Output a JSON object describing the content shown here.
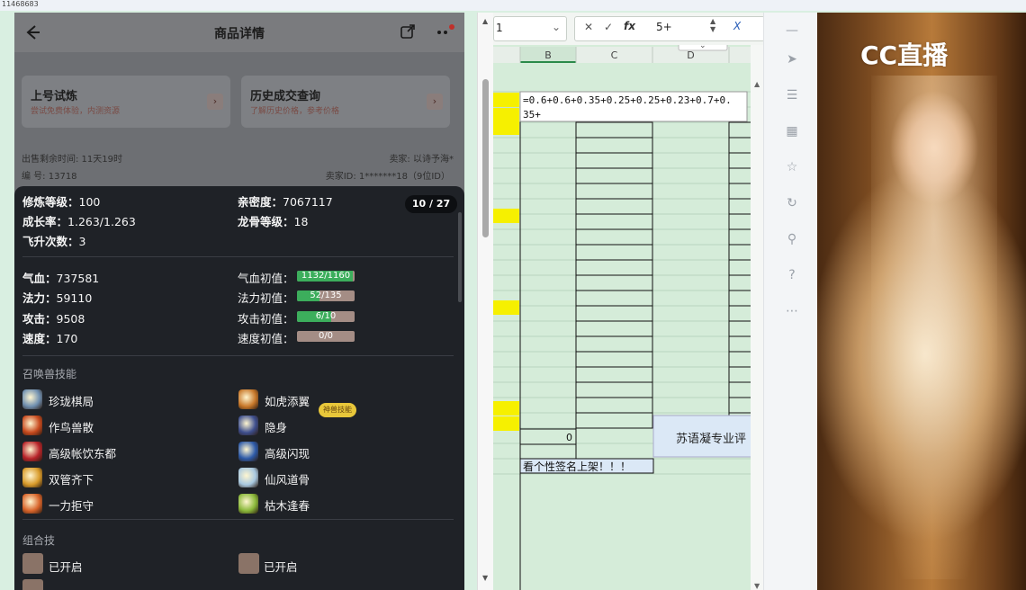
{
  "top_strip": {
    "text": "11468683"
  },
  "phone": {
    "header_title": "商品详情",
    "cards": [
      {
        "title": "上号试炼",
        "subtitle": "尝试免费体验，内测资源"
      },
      {
        "title": "历史成交查询",
        "subtitle": "了解历史价格，参考价格"
      }
    ],
    "meta": {
      "sell_time": "出售剩余时间: 11天19时",
      "seller": "卖家: 以诗予海*",
      "serial": "编 号: 13718",
      "seller_id": "卖家ID: 1*******18（9位ID）"
    },
    "detail": {
      "page_badge": "10 / 27",
      "stats_top": [
        {
          "label": "修炼等级：",
          "value": "100"
        },
        {
          "label": "亲密度：",
          "value": "7067117"
        },
        {
          "label": "成长率：",
          "value": "1.263/1.263"
        },
        {
          "label": "龙骨等级：",
          "value": "18"
        },
        {
          "label": "飞升次数：",
          "value": "3"
        }
      ],
      "stats_main": [
        {
          "label": "气血：",
          "value": "737581"
        },
        {
          "label": "法力：",
          "value": "59110"
        },
        {
          "label": "攻击：",
          "value": "9508"
        },
        {
          "label": "速度：",
          "value": "170"
        }
      ],
      "initials": [
        {
          "label": "气血初值：",
          "text": "1132/1160",
          "fraction": 0.976
        },
        {
          "label": "法力初值：",
          "text": "52/135",
          "fraction": 0.385
        },
        {
          "label": "攻击初值：",
          "text": "6/10",
          "fraction": 0.6
        },
        {
          "label": "速度初值：",
          "text": "0/0",
          "fraction": 0
        }
      ],
      "skills_title": "召唤兽技能",
      "skills": [
        {
          "name": "珍珑棋局",
          "color": "#6f8fb0"
        },
        {
          "name": "如虎添翼",
          "color": "#c8782a"
        },
        {
          "name": "作鸟兽散",
          "color": "#c84a1e"
        },
        {
          "name": "隐身",
          "color": "#3e4f8e"
        },
        {
          "name": "高级帐饮东都",
          "color": "#b8242a"
        },
        {
          "name": "高级闪现",
          "color": "#2d5aa8"
        },
        {
          "name": "双管齐下",
          "color": "#d89a2a"
        },
        {
          "name": "仙风道骨",
          "color": "#a8c8e0"
        },
        {
          "name": "一力拒守",
          "color": "#d8642a"
        },
        {
          "name": "枯木逢春",
          "color": "#8ab83a"
        }
      ],
      "special_badge": "神兽技能",
      "combo_title": "组合技",
      "combos": [
        {
          "label": "已开启"
        },
        {
          "label": "已开启"
        }
      ]
    }
  },
  "sheet": {
    "name_box": "1",
    "formula_value": "5+",
    "columns": [
      "B",
      "C",
      "D"
    ],
    "formula_text_line1": "=0.6+0.6+0.35+0.25+0.25+0.23+0.7+0.",
    "formula_text_line2": "35+",
    "cell_zero": "0",
    "cell_text_1": "苏语凝专业评",
    "cell_text_2": "看个性签名上架！！！"
  },
  "photo": {
    "logo_text": "CC直播"
  }
}
